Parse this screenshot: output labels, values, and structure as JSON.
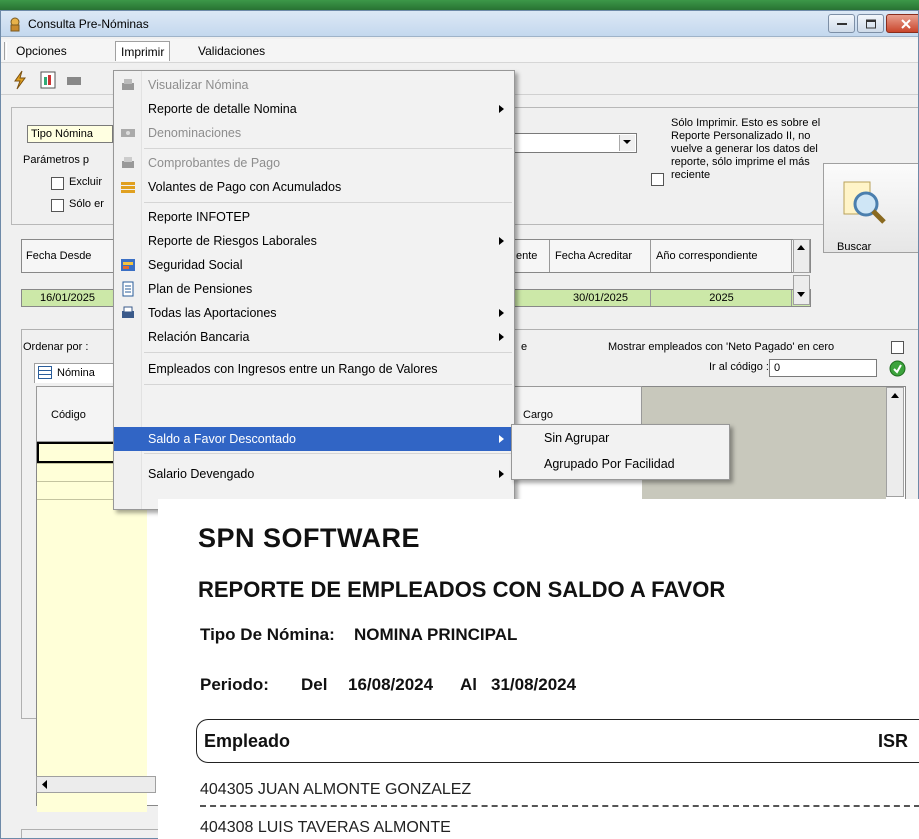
{
  "window": {
    "title": "Consulta Pre-Nóminas"
  },
  "menubar": {
    "items": [
      "Opciones",
      "Imprimir",
      "Validaciones"
    ]
  },
  "dropdown": {
    "items": [
      {
        "label": "Visualizar Nómina",
        "disabled": true,
        "icon": "print-icon",
        "submenu": false
      },
      {
        "label": "Reporte de detalle Nomina",
        "disabled": false,
        "icon": "",
        "submenu": true
      },
      {
        "label": "Denominaciones",
        "disabled": true,
        "icon": "cash-icon",
        "submenu": false
      },
      {
        "label": "Comprobantes de Pago",
        "disabled": true,
        "icon": "printer-icon",
        "submenu": false
      },
      {
        "label": "Volantes de Pago con Acumulados",
        "disabled": false,
        "icon": "money-stack-icon",
        "submenu": false
      },
      {
        "label": "Reporte INFOTEP",
        "disabled": false,
        "icon": "",
        "submenu": false
      },
      {
        "label": "Reporte de Riesgos Laborales",
        "disabled": false,
        "icon": "",
        "submenu": true
      },
      {
        "label": "Seguridad Social",
        "disabled": false,
        "icon": "security-icon",
        "submenu": false
      },
      {
        "label": "Plan de Pensiones",
        "disabled": false,
        "icon": "document-icon",
        "submenu": false
      },
      {
        "label": "Todas las Aportaciones",
        "disabled": false,
        "icon": "printer-icon",
        "submenu": true
      },
      {
        "label": "Relación Bancaria",
        "disabled": false,
        "icon": "",
        "submenu": true
      },
      {
        "label": "Empleados con Ingresos entre un Rango de Valores",
        "disabled": false,
        "icon": "",
        "submenu": false
      },
      {
        "label": "Saldo a Favor Descontado",
        "disabled": false,
        "icon": "",
        "submenu": true,
        "highlighted": true
      },
      {
        "label": "Salario Devengado",
        "disabled": false,
        "icon": "",
        "submenu": true
      }
    ]
  },
  "submenu": {
    "items": [
      "Sin Agrupar",
      "Agrupado Por Facilidad"
    ]
  },
  "filters": {
    "tipo_nomina_label": "Tipo Nómina",
    "params_label": "Parámetros p",
    "excluir_label": "Excluir",
    "solo_label": "Sólo er",
    "note": "Sólo Imprimir. Esto es sobre el Reporte Personalizado II, no vuelve a generar los datos del reporte, sólo imprime el más reciente",
    "buscar_label": "Buscar"
  },
  "period_grid": {
    "headers": [
      "Fecha Desde",
      "ente",
      "Fecha Acreditar",
      "Año correspondiente"
    ],
    "row": [
      "16/01/2025",
      "30/01/2025",
      "2025"
    ]
  },
  "employees": {
    "ordenar_label": "Ordenar por :",
    "ordenar_suffix": "e",
    "mostrar_label": "Mostrar empleados con 'Neto Pagado' en cero",
    "ir_label": "Ir al código :",
    "ir_value": "0",
    "tab_label": "Nómina",
    "col_codigo": "Código",
    "col_cargo": "Cargo"
  },
  "report": {
    "company": "SPN SOFTWARE",
    "title": "REPORTE DE EMPLEADOS CON SALDO A FAVOR",
    "tipo_label": "Tipo De Nómina:",
    "tipo_value": "NOMINA PRINCIPAL",
    "periodo_label": "Periodo:",
    "periodo_del": "Del",
    "periodo_from": "16/08/2024",
    "periodo_al": "Al",
    "periodo_to": "31/08/2024",
    "col_empleado": "Empleado",
    "col_isr": "ISR",
    "rows": [
      "404305 JUAN ALMONTE GONZALEZ",
      "404308 LUIS TAVERAS ALMONTE"
    ]
  }
}
